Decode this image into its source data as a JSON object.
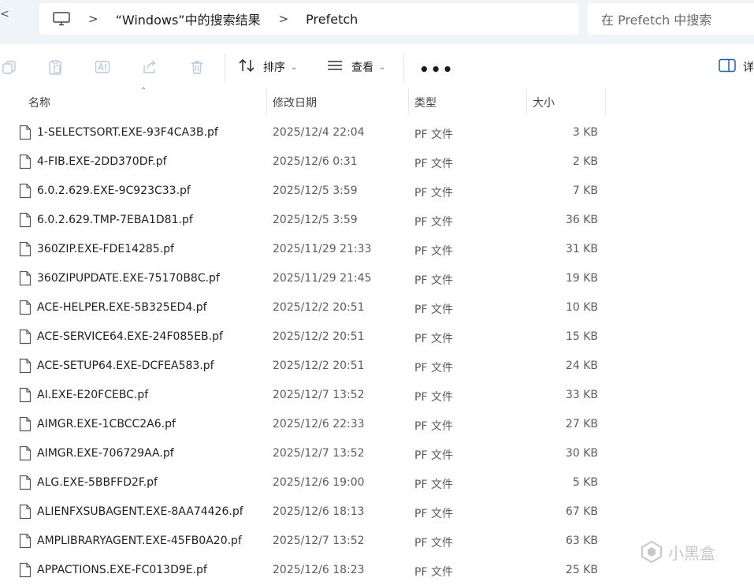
{
  "address": {
    "back_glyph": "<",
    "separator": ">",
    "crumbs": [
      "“Windows”中的搜索结果",
      "Prefetch"
    ]
  },
  "search": {
    "placeholder": "在 Prefetch 中搜索"
  },
  "toolbar": {
    "sort_label": "排序",
    "view_label": "查看",
    "more_label": "•••",
    "details_label": "详"
  },
  "columns": {
    "name": "名称",
    "modified": "修改日期",
    "type": "类型",
    "size": "大小"
  },
  "files": [
    {
      "name": "1-SELECTSORT.EXE-93F4CA3B.pf",
      "modified": "2025/12/4 22:04",
      "type": "PF 文件",
      "size": "3 KB"
    },
    {
      "name": "4-FIB.EXE-2DD370DF.pf",
      "modified": "2025/12/6 0:31",
      "type": "PF 文件",
      "size": "2 KB"
    },
    {
      "name": "6.0.2.629.EXE-9C923C33.pf",
      "modified": "2025/12/5 3:59",
      "type": "PF 文件",
      "size": "7 KB"
    },
    {
      "name": "6.0.2.629.TMP-7EBA1D81.pf",
      "modified": "2025/12/5 3:59",
      "type": "PF 文件",
      "size": "36 KB"
    },
    {
      "name": "360ZIP.EXE-FDE14285.pf",
      "modified": "2025/11/29 21:33",
      "type": "PF 文件",
      "size": "31 KB"
    },
    {
      "name": "360ZIPUPDATE.EXE-75170B8C.pf",
      "modified": "2025/11/29 21:45",
      "type": "PF 文件",
      "size": "19 KB"
    },
    {
      "name": "ACE-HELPER.EXE-5B325ED4.pf",
      "modified": "2025/12/2 20:51",
      "type": "PF 文件",
      "size": "10 KB"
    },
    {
      "name": "ACE-SERVICE64.EXE-24F085EB.pf",
      "modified": "2025/12/2 20:51",
      "type": "PF 文件",
      "size": "15 KB"
    },
    {
      "name": "ACE-SETUP64.EXE-DCFEA583.pf",
      "modified": "2025/12/2 20:51",
      "type": "PF 文件",
      "size": "24 KB"
    },
    {
      "name": "AI.EXE-E20FCEBC.pf",
      "modified": "2025/12/7 13:52",
      "type": "PF 文件",
      "size": "33 KB"
    },
    {
      "name": "AIMGR.EXE-1CBCC2A6.pf",
      "modified": "2025/12/6 22:33",
      "type": "PF 文件",
      "size": "27 KB"
    },
    {
      "name": "AIMGR.EXE-706729AA.pf",
      "modified": "2025/12/7 13:52",
      "type": "PF 文件",
      "size": "30 KB"
    },
    {
      "name": "ALG.EXE-5BBFFD2F.pf",
      "modified": "2025/12/6 19:00",
      "type": "PF 文件",
      "size": "5 KB"
    },
    {
      "name": "ALIENFXSUBAGENT.EXE-8AA74426.pf",
      "modified": "2025/12/6 18:13",
      "type": "PF 文件",
      "size": "67 KB"
    },
    {
      "name": "AMPLIBRARYAGENT.EXE-45FB0A20.pf",
      "modified": "2025/12/7 13:52",
      "type": "PF 文件",
      "size": "63 KB"
    },
    {
      "name": "APPACTIONS.EXE-FC013D9E.pf",
      "modified": "2025/12/6 18:23",
      "type": "PF 文件",
      "size": "25 KB"
    }
  ],
  "watermark": {
    "text": "小黑盒"
  }
}
